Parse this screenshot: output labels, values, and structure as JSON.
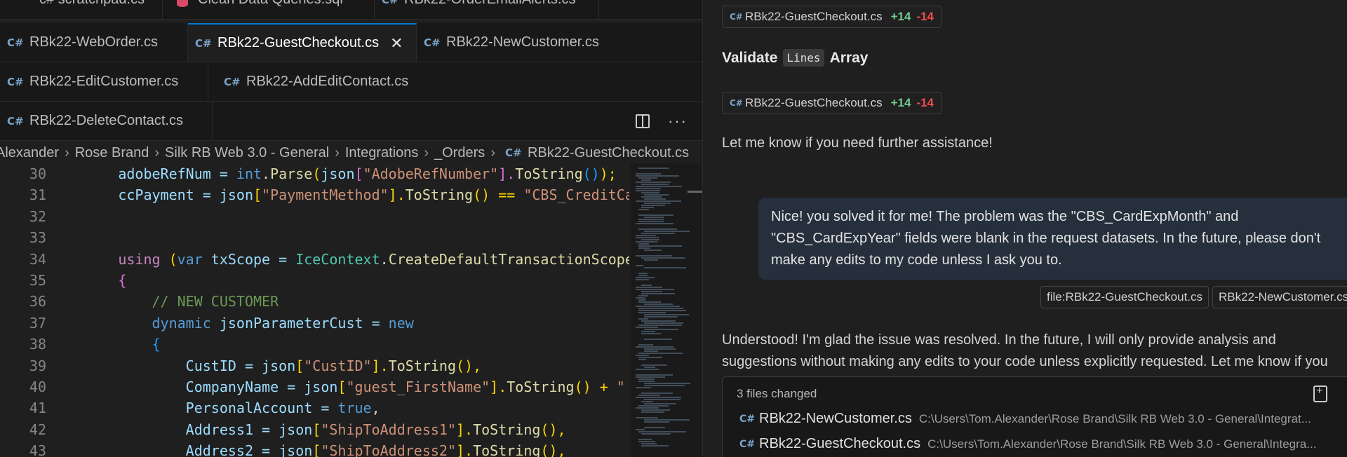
{
  "editor": {
    "tab_rows": [
      [
        {
          "icon": "csharp-icon",
          "label": "c# scratchpad.cs"
        },
        {
          "icon": "database-icon",
          "label": "Clean Data Queries.sql"
        },
        {
          "icon": "csharp-icon",
          "label": "RBk22-OrderEmailAlerts.cs"
        }
      ],
      [
        {
          "icon": "csharp-icon",
          "label": "RBk22-WebOrder.cs"
        },
        {
          "icon": "csharp-icon",
          "label": "RBk22-GuestCheckout.cs",
          "active": true
        },
        {
          "icon": "csharp-icon",
          "label": "RBk22-NewCustomer.cs"
        }
      ],
      [
        {
          "icon": "csharp-icon",
          "label": "RBk22-EditCustomer.cs"
        },
        {
          "icon": "csharp-icon",
          "label": "RBk22-AddEditContact.cs"
        }
      ],
      [
        {
          "icon": "csharp-icon",
          "label": "RBk22-DeleteContact.cs"
        }
      ]
    ],
    "breadcrumb": [
      "Alexander",
      "Rose Brand",
      "Silk RB Web 3.0 - General",
      "Integrations",
      "_Orders",
      "RBk22-GuestCheckout.cs"
    ],
    "line_numbers": [
      "30",
      "31",
      "32",
      "33",
      "34",
      "35",
      "36",
      "37",
      "38",
      "39",
      "40",
      "41",
      "42",
      "43"
    ],
    "code": {
      "l30_a": "adobeRefNum = ",
      "l30_b": "int",
      "l30_c": ".",
      "l30_d": "Parse",
      "l30_e": "(",
      "l30_f": "json",
      "l30_g": "[",
      "l30_h": "\"AdobeRefNumber\"",
      "l30_i": "].",
      "l30_j": "ToString",
      "l30_k": "()",
      "l30_l": ");",
      "l31_a": "ccPayment = ",
      "l31_b": "json",
      "l31_c": "[",
      "l31_d": "\"PaymentMethod\"",
      "l31_e": "].",
      "l31_f": "ToString",
      "l31_g": "() == ",
      "l31_h": "\"CBS_CreditCa",
      "l34_a": "using",
      "l34_b": " (",
      "l34_c": "var",
      "l34_d": " txScope = ",
      "l34_e": "IceContext",
      "l34_f": ".",
      "l34_g": "CreateDefaultTransactionScope",
      "l35": "{",
      "l36": "// NEW CUSTOMER",
      "l37_a": "dynamic",
      "l37_b": " jsonParameterCust = ",
      "l37_c": "new",
      "l38": "{",
      "l39_a": "CustID = ",
      "l39_b": "json",
      "l39_c": "[",
      "l39_d": "\"CustID\"",
      "l39_e": "].",
      "l39_f": "ToString",
      "l39_g": "(),",
      "l40_a": "CompanyName = ",
      "l40_b": "json",
      "l40_c": "[",
      "l40_d": "\"guest_FirstName\"",
      "l40_e": "].",
      "l40_f": "ToString",
      "l40_g": "() + ",
      "l40_h": "\"",
      "l41_a": "PersonalAccount = ",
      "l41_b": "true",
      "l41_c": ",",
      "l42_a": "Address1 = ",
      "l42_b": "json",
      "l42_c": "[",
      "l42_d": "\"ShipToAddress1\"",
      "l42_e": "].",
      "l42_f": "ToString",
      "l42_g": "(),",
      "l43_a": "Address2 = ",
      "l43_b": "json",
      "l43_c": "[",
      "l43_d": "\"ShipToAddress2\"",
      "l43_e": "].",
      "l43_f": "ToString",
      "l43_g": "(),"
    }
  },
  "chat": {
    "chip1": {
      "file": "RBk22-GuestCheckout.cs",
      "added": "+14",
      "removed": "-14"
    },
    "heading_a": "Validate",
    "heading_code": "Lines",
    "heading_b": "Array",
    "chip2": {
      "file": "RBk22-GuestCheckout.cs",
      "added": "+14",
      "removed": "-14"
    },
    "assist_closing": "Let me know if you need further assistance!",
    "user_message_lines": [
      "Nice! you solved it for me! The problem was the \"CBS_CardExpMonth\" and",
      "\"CBS_CardExpYear\" fields were blank in the request datasets. In the future, please don't",
      "make any edits to my code unless I ask you to."
    ],
    "refs": [
      "file:RBk22-GuestCheckout.cs",
      "RBk22-NewCustomer.cs"
    ],
    "reply_lines": [
      "Understood! I'm glad the issue was resolved. In the future, I will only provide analysis and",
      "suggestions without making any edits to your code unless explicitly requested. Let me know if you"
    ],
    "files_changed": {
      "title": "3 files changed",
      "files": [
        {
          "name": "RBk22-NewCustomer.cs",
          "path": "C:\\Users\\Tom.Alexander\\Rose Brand\\Silk RB Web 3.0 - General\\Integrat..."
        },
        {
          "name": "RBk22-GuestCheckout.cs",
          "path": "C:\\Users\\Tom.Alexander\\Rose Brand\\Silk RB Web 3.0 - General\\Integra..."
        }
      ]
    }
  },
  "colors": {
    "accent": "#0078d4",
    "added": "#73c991",
    "removed": "#f14c4c",
    "user_bubble": "#26303d"
  }
}
